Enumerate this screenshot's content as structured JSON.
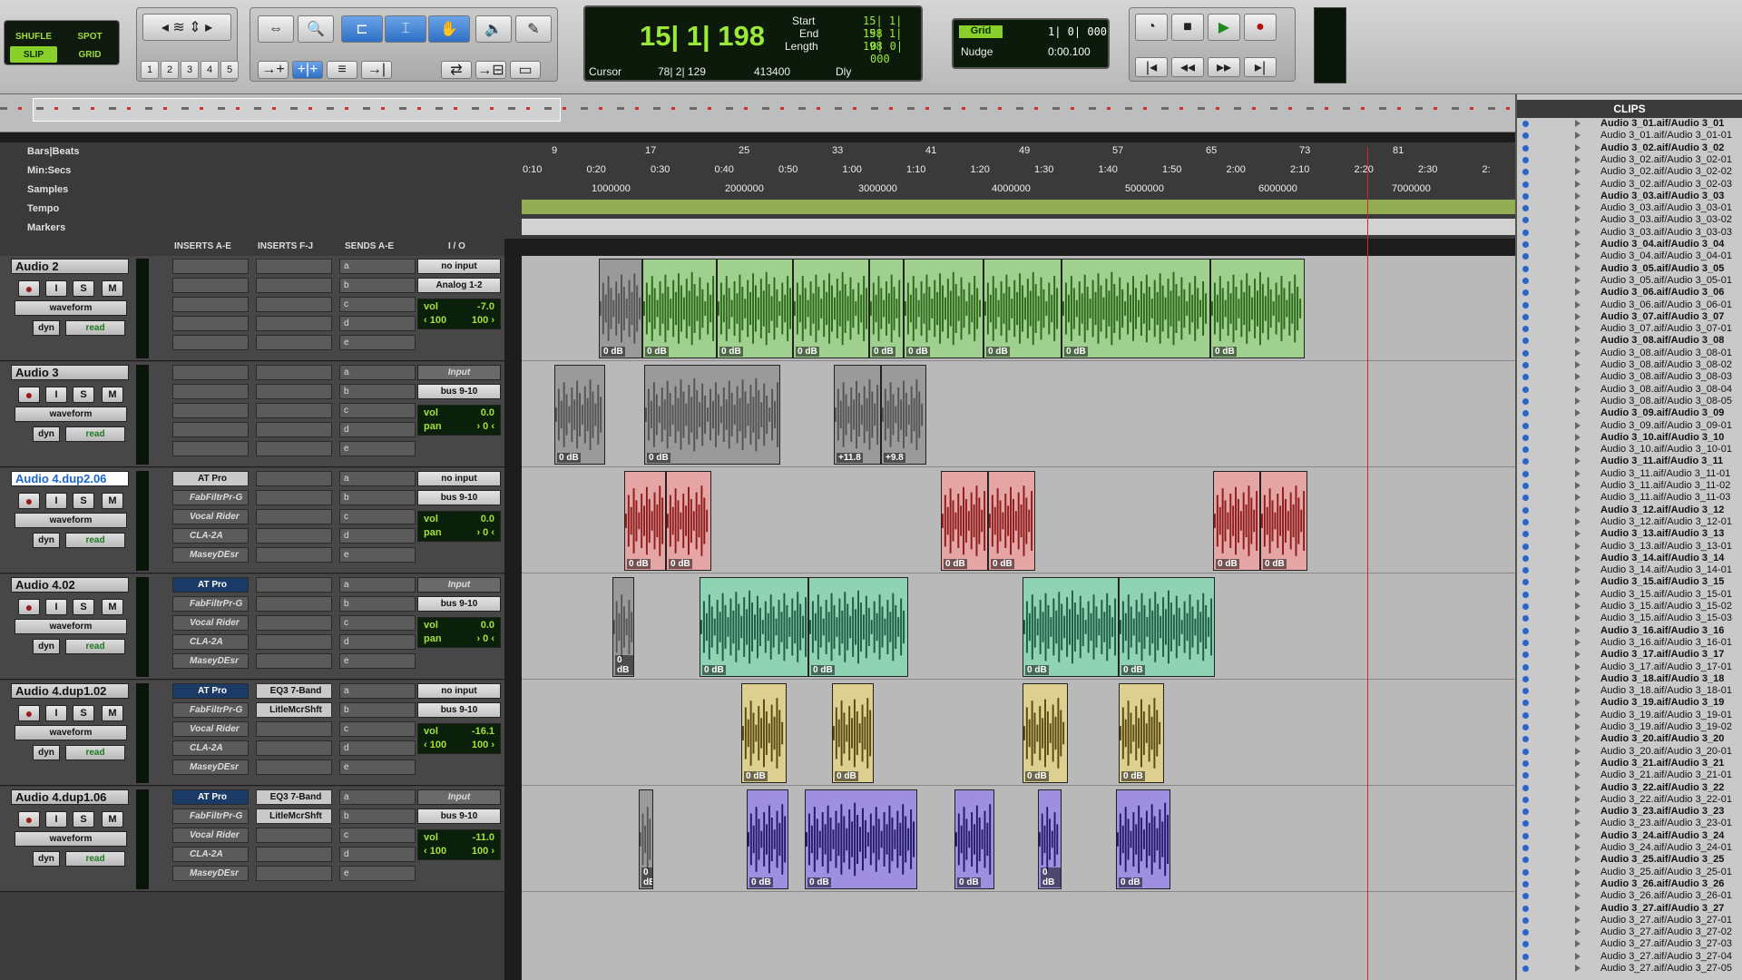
{
  "toolbar": {
    "modes": [
      "SHUFLE",
      "SPOT",
      "SLIP",
      "GRID"
    ],
    "zoom_presets": [
      "1",
      "2",
      "3",
      "4",
      "5"
    ],
    "main_counter": "15| 1| 198",
    "start_label": "Start",
    "start_val": "15| 1| 198",
    "end_label": "End",
    "end_val": "15| 1| 198",
    "length_label": "Length",
    "length_val": "0| 0| 000",
    "cursor_label": "Cursor",
    "cursor_val": "78| 2| 129",
    "samples_val": "413400",
    "dly_label": "Dly",
    "grid_label": "Grid",
    "grid_val": "1| 0| 000",
    "nudge_label": "Nudge",
    "nudge_val": "0:00.100"
  },
  "rulers": {
    "names": [
      "Bars|Beats",
      "Min:Secs",
      "Samples",
      "Tempo",
      "Markers"
    ],
    "bars": [
      "9",
      "17",
      "25",
      "33",
      "41",
      "49",
      "57",
      "65",
      "73",
      "81"
    ],
    "mins": [
      "0:10",
      "0:20",
      "0:30",
      "0:40",
      "0:50",
      "1:00",
      "1:10",
      "1:20",
      "1:30",
      "1:40",
      "1:50",
      "2:00",
      "2:10",
      "2:20",
      "2:30",
      "2:"
    ],
    "samples": [
      "1000000",
      "2000000",
      "3000000",
      "4000000",
      "5000000",
      "6000000",
      "7000000"
    ]
  },
  "columns": {
    "inserts_ae": "INSERTS A-E",
    "inserts_fj": "INSERTS F-J",
    "sends": "SENDS A-E",
    "io": "I / O"
  },
  "tracks": [
    {
      "name": "Audio 2",
      "view": "waveform",
      "dyn": "dyn",
      "auto": "read",
      "inserts": [],
      "inserts2": [],
      "sends": [
        "a",
        "b",
        "c",
        "d",
        "e"
      ],
      "input": "no input",
      "output": "Analog 1-2",
      "vol": "-7.0",
      "pan_l": "‹ 100",
      "pan_r": "100 ›"
    },
    {
      "name": "Audio 3",
      "view": "waveform",
      "dyn": "dyn",
      "auto": "read",
      "inserts": [],
      "inserts2": [],
      "sends": [
        "a",
        "b",
        "c",
        "d",
        "e"
      ],
      "input": "Input",
      "output": "bus 9-10",
      "vol": "0.0",
      "pan_l": "pan",
      "pan_r": "› 0 ‹"
    },
    {
      "name": "Audio 4.dup2.06",
      "view": "waveform",
      "dyn": "dyn",
      "auto": "read",
      "inserts": [
        "AT Pro",
        "FabFiltrPr-G",
        "Vocal Rider",
        "CLA-2A",
        "MaseyDEsr"
      ],
      "inserts2": [],
      "sends": [
        "a",
        "b",
        "c",
        "d",
        "e"
      ],
      "input": "no input",
      "output": "bus 9-10",
      "vol": "0.0",
      "pan_l": "pan",
      "pan_r": "› 0 ‹"
    },
    {
      "name": "Audio 4.02",
      "view": "waveform",
      "dyn": "dyn",
      "auto": "read",
      "inserts": [
        "AT Pro",
        "FabFiltrPr-G",
        "Vocal Rider",
        "CLA-2A",
        "MaseyDEsr"
      ],
      "inserts2": [],
      "sends": [
        "a",
        "b",
        "c",
        "d",
        "e"
      ],
      "input": "Input",
      "output": "bus 9-10",
      "vol": "0.0",
      "pan_l": "pan",
      "pan_r": "› 0 ‹"
    },
    {
      "name": "Audio 4.dup1.02",
      "view": "waveform",
      "dyn": "dyn",
      "auto": "read",
      "inserts": [
        "AT Pro",
        "FabFiltrPr-G",
        "Vocal Rider",
        "CLA-2A",
        "MaseyDEsr"
      ],
      "inserts2": [
        "EQ3 7-Band",
        "LitleMcrShft"
      ],
      "sends": [
        "a",
        "b",
        "c",
        "d",
        "e"
      ],
      "input": "no input",
      "output": "bus 9-10",
      "vol": "-16.1",
      "pan_l": "‹ 100",
      "pan_r": "100 ›"
    },
    {
      "name": "Audio 4.dup1.06",
      "view": "waveform",
      "dyn": "dyn",
      "auto": "read",
      "inserts": [
        "AT Pro",
        "FabFiltrPr-G",
        "Vocal Rider",
        "CLA-2A",
        "MaseyDEsr"
      ],
      "inserts2": [
        "EQ3 7-Band",
        "LitleMcrShft"
      ],
      "sends": [
        "a",
        "b",
        "c",
        "d",
        "e"
      ],
      "input": "Input",
      "output": "bus 9-10",
      "vol": "-11.0",
      "pan_l": "‹ 100",
      "pan_r": "100 ›"
    }
  ],
  "strip_labels": {
    "vol": "vol"
  },
  "clip_gain": "0 dB",
  "clip_gain_alt": [
    "+11.8",
    "+9.8"
  ],
  "clips_header": "CLIPS",
  "clips": [
    {
      "t": "Audio 3_01.aif/Audio 3_01",
      "b": true
    },
    {
      "t": "Audio 3_01.aif/Audio 3_01-01",
      "b": false
    },
    {
      "t": "Audio 3_02.aif/Audio 3_02",
      "b": true
    },
    {
      "t": "Audio 3_02.aif/Audio 3_02-01",
      "b": false
    },
    {
      "t": "Audio 3_02.aif/Audio 3_02-02",
      "b": false
    },
    {
      "t": "Audio 3_02.aif/Audio 3_02-03",
      "b": false
    },
    {
      "t": "Audio 3_03.aif/Audio 3_03",
      "b": true
    },
    {
      "t": "Audio 3_03.aif/Audio 3_03-01",
      "b": false
    },
    {
      "t": "Audio 3_03.aif/Audio 3_03-02",
      "b": false
    },
    {
      "t": "Audio 3_03.aif/Audio 3_03-03",
      "b": false
    },
    {
      "t": "Audio 3_04.aif/Audio 3_04",
      "b": true
    },
    {
      "t": "Audio 3_04.aif/Audio 3_04-01",
      "b": false
    },
    {
      "t": "Audio 3_05.aif/Audio 3_05",
      "b": true
    },
    {
      "t": "Audio 3_05.aif/Audio 3_05-01",
      "b": false
    },
    {
      "t": "Audio 3_06.aif/Audio 3_06",
      "b": true
    },
    {
      "t": "Audio 3_06.aif/Audio 3_06-01",
      "b": false
    },
    {
      "t": "Audio 3_07.aif/Audio 3_07",
      "b": true
    },
    {
      "t": "Audio 3_07.aif/Audio 3_07-01",
      "b": false
    },
    {
      "t": "Audio 3_08.aif/Audio 3_08",
      "b": true
    },
    {
      "t": "Audio 3_08.aif/Audio 3_08-01",
      "b": false
    },
    {
      "t": "Audio 3_08.aif/Audio 3_08-02",
      "b": false
    },
    {
      "t": "Audio 3_08.aif/Audio 3_08-03",
      "b": false
    },
    {
      "t": "Audio 3_08.aif/Audio 3_08-04",
      "b": false
    },
    {
      "t": "Audio 3_08.aif/Audio 3_08-05",
      "b": false
    },
    {
      "t": "Audio 3_09.aif/Audio 3_09",
      "b": true
    },
    {
      "t": "Audio 3_09.aif/Audio 3_09-01",
      "b": false
    },
    {
      "t": "Audio 3_10.aif/Audio 3_10",
      "b": true
    },
    {
      "t": "Audio 3_10.aif/Audio 3_10-01",
      "b": false
    },
    {
      "t": "Audio 3_11.aif/Audio 3_11",
      "b": true
    },
    {
      "t": "Audio 3_11.aif/Audio 3_11-01",
      "b": false
    },
    {
      "t": "Audio 3_11.aif/Audio 3_11-02",
      "b": false
    },
    {
      "t": "Audio 3_11.aif/Audio 3_11-03",
      "b": false
    },
    {
      "t": "Audio 3_12.aif/Audio 3_12",
      "b": true
    },
    {
      "t": "Audio 3_12.aif/Audio 3_12-01",
      "b": false
    },
    {
      "t": "Audio 3_13.aif/Audio 3_13",
      "b": true
    },
    {
      "t": "Audio 3_13.aif/Audio 3_13-01",
      "b": false
    },
    {
      "t": "Audio 3_14.aif/Audio 3_14",
      "b": true
    },
    {
      "t": "Audio 3_14.aif/Audio 3_14-01",
      "b": false
    },
    {
      "t": "Audio 3_15.aif/Audio 3_15",
      "b": true
    },
    {
      "t": "Audio 3_15.aif/Audio 3_15-01",
      "b": false
    },
    {
      "t": "Audio 3_15.aif/Audio 3_15-02",
      "b": false
    },
    {
      "t": "Audio 3_15.aif/Audio 3_15-03",
      "b": false
    },
    {
      "t": "Audio 3_16.aif/Audio 3_16",
      "b": true
    },
    {
      "t": "Audio 3_16.aif/Audio 3_16-01",
      "b": false
    },
    {
      "t": "Audio 3_17.aif/Audio 3_17",
      "b": true
    },
    {
      "t": "Audio 3_17.aif/Audio 3_17-01",
      "b": false
    },
    {
      "t": "Audio 3_18.aif/Audio 3_18",
      "b": true
    },
    {
      "t": "Audio 3_18.aif/Audio 3_18-01",
      "b": false
    },
    {
      "t": "Audio 3_19.aif/Audio 3_19",
      "b": true
    },
    {
      "t": "Audio 3_19.aif/Audio 3_19-01",
      "b": false
    },
    {
      "t": "Audio 3_19.aif/Audio 3_19-02",
      "b": false
    },
    {
      "t": "Audio 3_20.aif/Audio 3_20",
      "b": true
    },
    {
      "t": "Audio 3_20.aif/Audio 3_20-01",
      "b": false
    },
    {
      "t": "Audio 3_21.aif/Audio 3_21",
      "b": true
    },
    {
      "t": "Audio 3_21.aif/Audio 3_21-01",
      "b": false
    },
    {
      "t": "Audio 3_22.aif/Audio 3_22",
      "b": true
    },
    {
      "t": "Audio 3_22.aif/Audio 3_22-01",
      "b": false
    },
    {
      "t": "Audio 3_23.aif/Audio 3_23",
      "b": true
    },
    {
      "t": "Audio 3_23.aif/Audio 3_23-01",
      "b": false
    },
    {
      "t": "Audio 3_24.aif/Audio 3_24",
      "b": true
    },
    {
      "t": "Audio 3_24.aif/Audio 3_24-01",
      "b": false
    },
    {
      "t": "Audio 3_25.aif/Audio 3_25",
      "b": true
    },
    {
      "t": "Audio 3_25.aif/Audio 3_25-01",
      "b": false
    },
    {
      "t": "Audio 3_26.aif/Audio 3_26",
      "b": true
    },
    {
      "t": "Audio 3_26.aif/Audio 3_26-01",
      "b": false
    },
    {
      "t": "Audio 3_27.aif/Audio 3_27",
      "b": true
    },
    {
      "t": "Audio 3_27.aif/Audio 3_27-01",
      "b": false
    },
    {
      "t": "Audio 3_27.aif/Audio 3_27-02",
      "b": false
    },
    {
      "t": "Audio 3_27.aif/Audio 3_27-03",
      "b": false
    },
    {
      "t": "Audio 3_27.aif/Audio 3_27-04",
      "b": false
    },
    {
      "t": "Audio 3_27.aif/Audio 3_27-05",
      "b": false
    }
  ],
  "colors": {
    "green": "#2f6a1c",
    "green_bg": "#9fd08f",
    "grey": "#666666",
    "red": "#8d1c1c",
    "red_bg": "#e6a5a5",
    "teal": "#1f5f45",
    "teal_bg": "#8fd2b4",
    "yellow": "#5a4a10",
    "yellow_bg": "#dccf8f",
    "purple": "#241a6a",
    "purple_bg": "#9f8fe0"
  }
}
